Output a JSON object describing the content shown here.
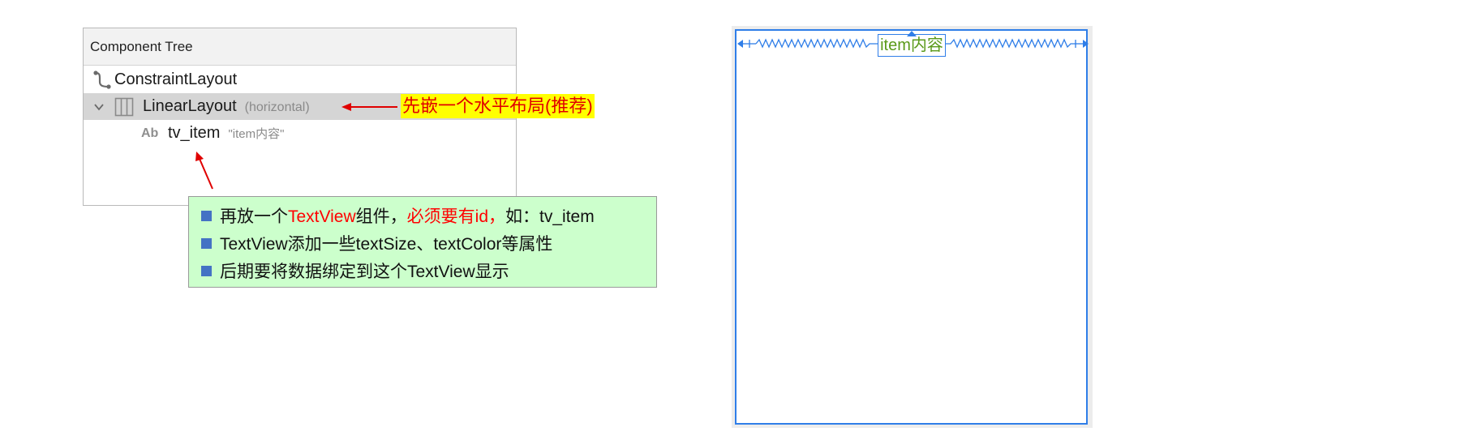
{
  "component_tree": {
    "title": "Component Tree",
    "nodes": [
      {
        "label": "ConstraintLayout",
        "sub": "",
        "icon": "constraint-layout-icon"
      },
      {
        "label": "LinearLayout",
        "sub": "(horizontal)",
        "icon": "linear-layout-icon",
        "expanded": true,
        "selected": true
      },
      {
        "label": "tv_item",
        "sub": "\"item内容\"",
        "icon": "text-view-icon",
        "icon_text": "Ab"
      }
    ]
  },
  "annotations": {
    "linear_layout_note": "先嵌一个水平布局(推荐)",
    "callout_lines": [
      {
        "parts": [
          "再放一个",
          "TextView",
          "组件，",
          "必须要有id，",
          "如：tv_item"
        ]
      },
      {
        "text": "TextView添加一些textSize、textColor等属性"
      },
      {
        "text": "后期要将数据绑定到这个TextView显示"
      }
    ]
  },
  "preview": {
    "item_text": "item内容"
  },
  "colors": {
    "highlight_yellow": "#ffff00",
    "annotation_red": "#e00000",
    "callout_green": "#ccffcc",
    "bullet_blue": "#4472c4",
    "blueprint_blue": "#2f7ee8",
    "preview_text_green": "#5a9a1a"
  }
}
